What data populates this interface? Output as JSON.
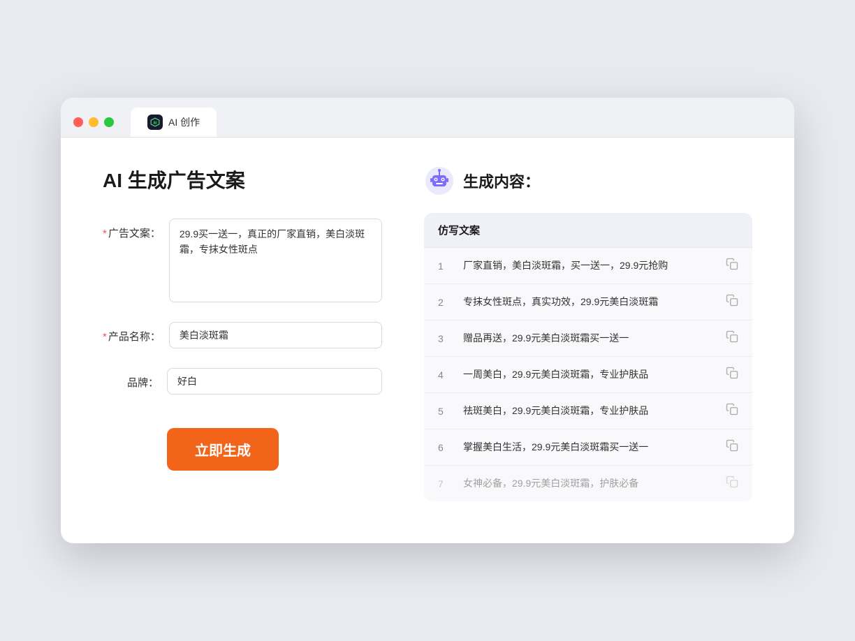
{
  "browser": {
    "tab_label": "AI 创作",
    "tab_icon_text": "AI"
  },
  "left_panel": {
    "title": "AI 生成广告文案",
    "fields": {
      "ad_copy": {
        "label": "广告文案：",
        "required": true,
        "value": "29.9买一送一，真正的厂家直销，美白淡斑霜，专抹女性斑点",
        "placeholder": ""
      },
      "product_name": {
        "label": "产品名称：",
        "required": true,
        "value": "美白淡斑霜",
        "placeholder": ""
      },
      "brand": {
        "label": "品牌：",
        "required": false,
        "value": "好白",
        "placeholder": ""
      }
    },
    "generate_button": "立即生成"
  },
  "right_panel": {
    "title": "生成内容：",
    "table_header": "仿写文案",
    "results": [
      {
        "num": "1",
        "text": "厂家直销，美白淡斑霜，买一送一，29.9元抢购",
        "faded": false
      },
      {
        "num": "2",
        "text": "专抹女性斑点，真实功效，29.9元美白淡斑霜",
        "faded": false
      },
      {
        "num": "3",
        "text": "赠品再送，29.9元美白淡斑霜买一送一",
        "faded": false
      },
      {
        "num": "4",
        "text": "一周美白，29.9元美白淡斑霜，专业护肤品",
        "faded": false
      },
      {
        "num": "5",
        "text": "祛斑美白，29.9元美白淡斑霜，专业护肤品",
        "faded": false
      },
      {
        "num": "6",
        "text": "掌握美白生活，29.9元美白淡斑霜买一送一",
        "faded": false
      },
      {
        "num": "7",
        "text": "女神必备，29.9元美白淡斑霜，护肤必备",
        "faded": true
      }
    ]
  }
}
